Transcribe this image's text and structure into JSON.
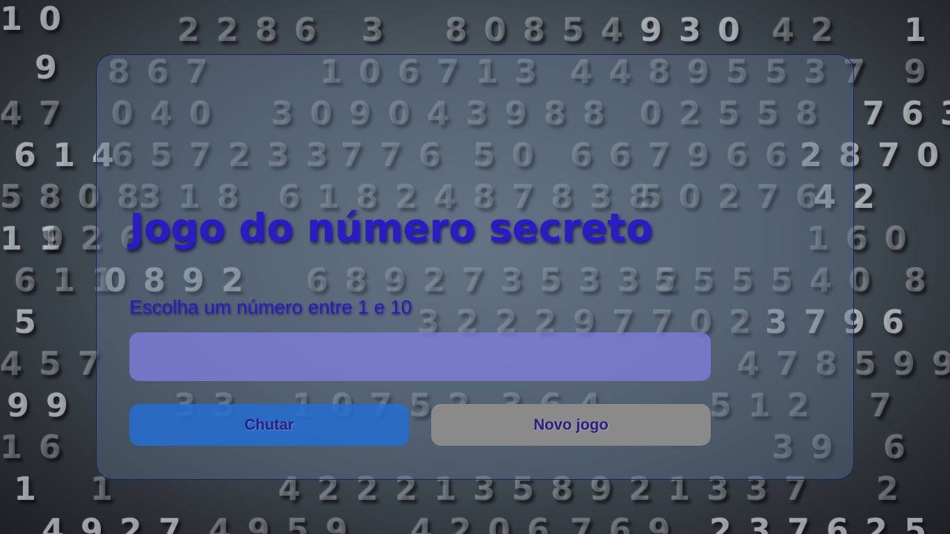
{
  "page": {
    "title": "Jogo do número secreto",
    "instruction": "Escolha um número entre 1 e 10",
    "input": {
      "value": "",
      "placeholder": ""
    },
    "buttons": {
      "guess_label": "Chutar",
      "new_game_label": "Novo jogo"
    }
  },
  "colors": {
    "title_text": "#2a1bc4",
    "input_background": "#8480e8",
    "guess_button": "#226ed7",
    "new_game_button": "#8a8a8a",
    "panel_border": "#1c1a6e"
  }
}
